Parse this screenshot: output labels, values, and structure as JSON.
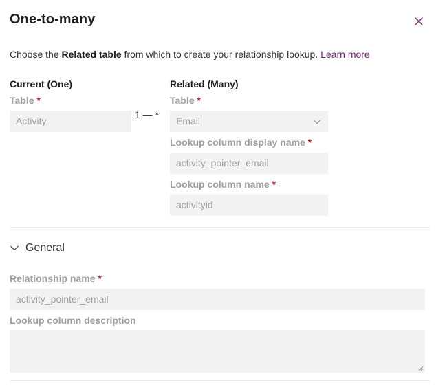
{
  "dialog": {
    "title": "One-to-many",
    "close_icon": "close-icon"
  },
  "intro": {
    "prefix": "Choose the ",
    "bold": "Related table",
    "suffix": " from which to create your relationship lookup. ",
    "link": "Learn more"
  },
  "current": {
    "heading": "Current (One)",
    "table_label": "Table",
    "table_value": "Activity"
  },
  "cardinality": "1 — *",
  "related": {
    "heading": "Related (Many)",
    "table_label": "Table",
    "table_value": "Email",
    "lookup_display_label": "Lookup column display name",
    "lookup_display_value": "activity_pointer_email",
    "lookup_name_label": "Lookup column name",
    "lookup_name_value": "activityid"
  },
  "general": {
    "label": "General",
    "expanded": true,
    "relationship_name_label": "Relationship name",
    "relationship_name_value": "activity_pointer_email",
    "lookup_description_label": "Lookup column description",
    "lookup_description_value": ""
  },
  "required_marker": "*",
  "colors": {
    "accent": "#742774",
    "required": "#a4262c",
    "field_bg": "#f3f2f1",
    "divider": "#edebe9"
  }
}
